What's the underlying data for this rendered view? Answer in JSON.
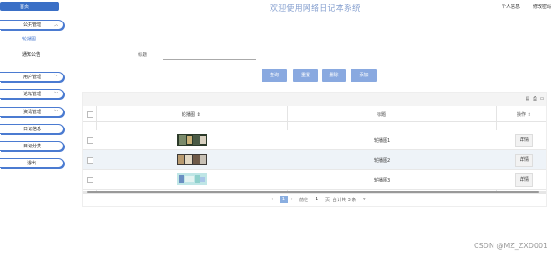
{
  "app": {
    "title": "欢迎使用网络日记本系统",
    "top_right": [
      "个人信息",
      "修改密码"
    ]
  },
  "sidebar": {
    "home": "首页",
    "items": [
      {
        "label": "公共管理",
        "expanded": true,
        "children": [
          "轮播图",
          "通知公告"
        ]
      },
      {
        "label": "用户管理",
        "expanded": false
      },
      {
        "label": "论坛管理",
        "expanded": false
      },
      {
        "label": "资讯管理",
        "expanded": false
      },
      {
        "label": "日记信息"
      },
      {
        "label": "日记分类"
      },
      {
        "label": "退出"
      }
    ]
  },
  "search": {
    "label": "标题",
    "value": "",
    "placeholder": ""
  },
  "buttons": {
    "query": "查询",
    "reset": "重置",
    "delete": "删除",
    "add": "添加"
  },
  "table": {
    "columns": [
      "轮播图",
      "标题",
      "操作"
    ],
    "rows": [
      {
        "title": "轮播图1",
        "action": "详情"
      },
      {
        "title": "轮播图2",
        "action": "详情"
      },
      {
        "title": "轮播图3",
        "action": "详情"
      }
    ]
  },
  "pagination": {
    "prev": "‹",
    "current": "1",
    "next": "›",
    "goto_label": "前往",
    "goto_value": "1",
    "page_unit": "页",
    "total_text": "合计共 3 条"
  },
  "watermark": "CSDN @MZ_ZXD001",
  "colors": {
    "accent": "#3a6fc6",
    "button": "#89a9e0",
    "title": "#8aa3d1"
  }
}
